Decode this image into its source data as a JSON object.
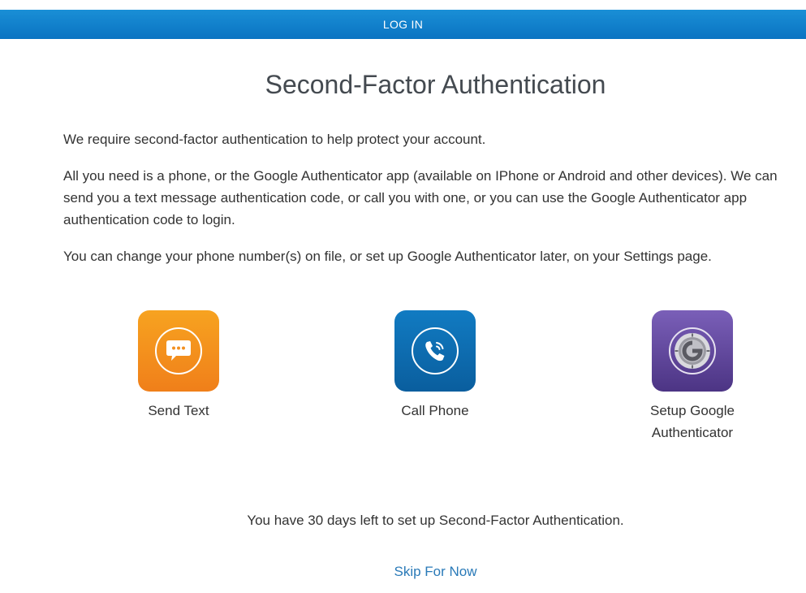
{
  "header": {
    "login_label": "LOG IN"
  },
  "page": {
    "title": "Second-Factor Authentication",
    "paragraphs": [
      "We require second-factor authentication to help protect your account.",
      "All you need is a phone, or the Google Authenticator app (available on IPhone or Android and other devices). We can send you a text message authentication code, or call you with one, or you can use the Google Authenticator app authentication code to login.",
      "You can change your phone number(s) on file, or set up Google Authenticator later, on your Settings page."
    ]
  },
  "options": [
    {
      "label": "Send Text",
      "icon": "chat-bubble-icon",
      "color": "#f39020"
    },
    {
      "label": "Call Phone",
      "icon": "phone-icon",
      "color": "#0d6cb0"
    },
    {
      "label": "Setup Google Authenticator",
      "icon": "google-authenticator-icon",
      "color": "#5f4599"
    }
  ],
  "footer": {
    "notice": "You have 30 days left to set up Second-Factor Authentication.",
    "skip_label": "Skip For Now"
  },
  "colors": {
    "header_bar": "#0a73c2",
    "link": "#2a7ab8"
  }
}
